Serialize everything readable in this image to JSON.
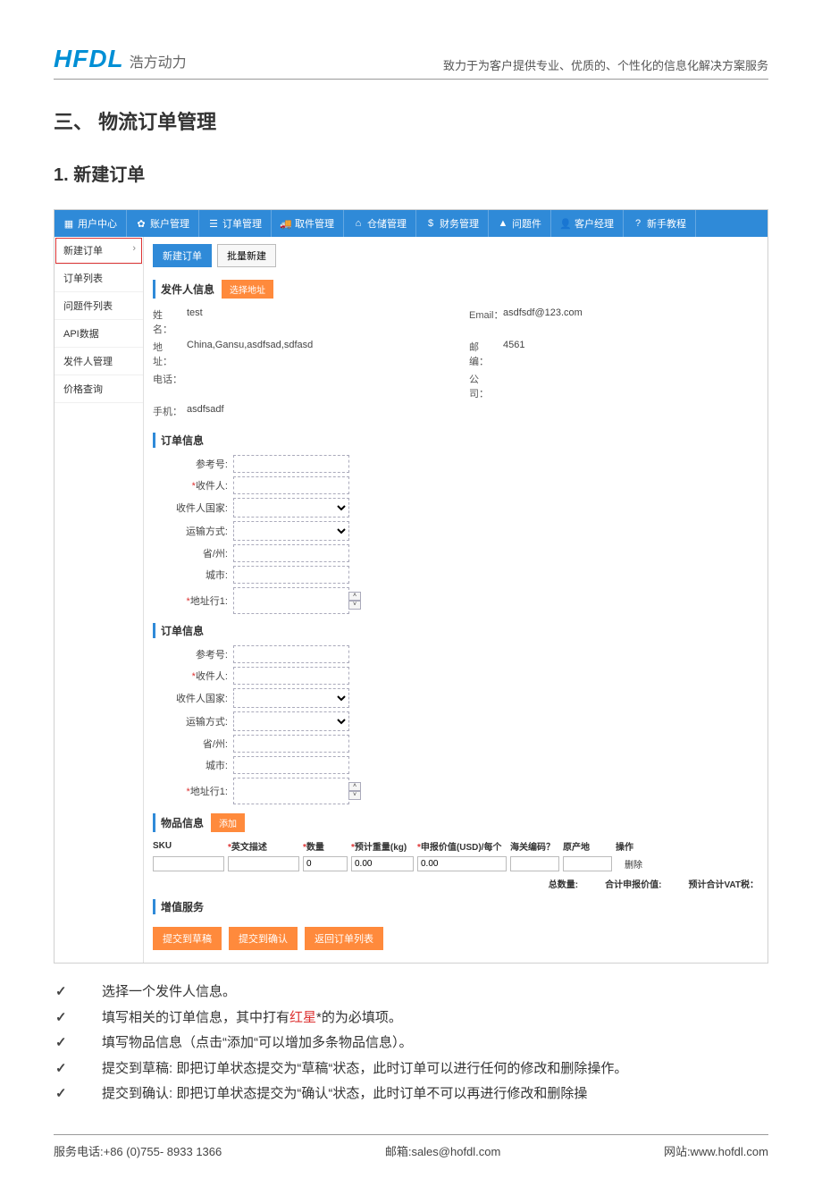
{
  "header": {
    "logo_mark": "HFDL",
    "logo_sub": "浩方动力",
    "slogan": "致力于为客户提供专业、优质的、个性化的信息化解决方案服务"
  },
  "headings": {
    "h1": "三、 物流订单管理",
    "h2": "1.  新建订单"
  },
  "topnav": {
    "t0": "用户中心",
    "t1": "账户管理",
    "t2": "订单管理",
    "t3": "取件管理",
    "t4": "仓储管理",
    "t5": "财务管理",
    "t6": "问题件",
    "t7": "客户经理",
    "t8": "新手教程"
  },
  "sidebar": {
    "s0": "新建订单",
    "s1": "订单列表",
    "s2": "问题件列表",
    "s3": "API数据",
    "s4": "发件人管理",
    "s5": "价格查询"
  },
  "toolbar": {
    "new": "新建订单",
    "batch": "批量新建"
  },
  "sender": {
    "title": "发件人信息",
    "choose": "选择地址",
    "name_l": "姓 名：",
    "name_v": "test",
    "addr_l": "地 址：",
    "addr_v": "China,Gansu,asdfsad,sdfasd",
    "tel_l": "电话：",
    "tel_v": "",
    "mob_l": "手机：",
    "mob_v": "asdfsadf",
    "email_l": "Email：",
    "email_v": "asdfsdf@123.com",
    "post_l": "邮 编：",
    "post_v": "4561",
    "comp_l": "公 司：",
    "comp_v": ""
  },
  "order": {
    "title": "订单信息",
    "ref": "参考号:",
    "recv": "收件人:",
    "country": "收件人国家:",
    "ship": "运输方式:",
    "prov": "省/州:",
    "city": "城市:",
    "addr1": "地址行1:"
  },
  "goods": {
    "title": "物品信息",
    "add": "添加",
    "h_sku": "SKU",
    "h_en": "英文描述",
    "h_qty": "数量",
    "h_wt": "预计重量(kg)",
    "h_val": "申报价值(USD)/每个",
    "h_hs": "海关编码",
    "h_orig": "原产地",
    "h_op": "操作",
    "qty_v": "0",
    "wt_v": "0.00",
    "val_v": "0.00",
    "del": "删除",
    "tot_qty": "总数量:",
    "tot_val": "合计申报价值:",
    "tot_vat": "预计合计VAT税："
  },
  "vas": {
    "title": "增值服务"
  },
  "submit": {
    "draft": "提交到草稿",
    "confirm": "提交到确认",
    "back": "返回订单列表"
  },
  "bullets": {
    "b0": "选择一个发件人信息。",
    "b1a": "填写相关的订单信息，其中打有",
    "b1r": "红星",
    "b1b": "*的为必填项。",
    "b2": "填写物品信息（点击“添加“可以增加多条物品信息）。",
    "b3": "提交到草稿: 即把订单状态提交为“草稿“状态，此时订单可以进行任何的修改和删除操作。",
    "b4": "提交到确认: 即把订单状态提交为“确认“状态，此时订单不可以再进行修改和删除操"
  },
  "footer": {
    "tel": "服务电话:+86 (0)755- 8933 1366",
    "mail": "邮箱:sales@hofdl.com",
    "site": "网站:www.hofdl.com"
  },
  "star": "*",
  "qmark": "？"
}
